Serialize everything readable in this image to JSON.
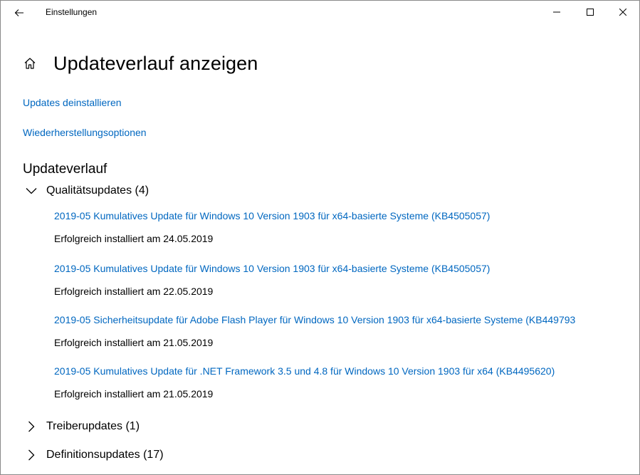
{
  "window": {
    "title": "Einstellungen",
    "controls": {
      "minimize": "—",
      "maximize": "☐",
      "close": "✕"
    },
    "back_icon": "arrow-left-icon"
  },
  "header": {
    "home_icon": "home-icon",
    "title": "Updateverlauf anzeigen"
  },
  "links": {
    "uninstall": "Updates deinstallieren",
    "recovery": "Wiederherstellungsoptionen"
  },
  "history": {
    "heading": "Updateverlauf",
    "groups": [
      {
        "label": "Qualitätsupdates (4)",
        "expanded": true,
        "items": [
          {
            "name": "2019-05 Kumulatives Update für Windows 10 Version 1903 für x64-basierte Systeme (KB4505057)",
            "status": "Erfolgreich installiert am 24.05.2019"
          },
          {
            "name": "2019-05 Kumulatives Update für Windows 10 Version 1903 für x64-basierte Systeme (KB4505057)",
            "status": "Erfolgreich installiert am 22.05.2019"
          },
          {
            "name": "2019-05 Sicherheitsupdate für Adobe Flash Player für Windows 10 Version 1903 für x64-basierte Systeme (KB449793",
            "status": "Erfolgreich installiert am 21.05.2019"
          },
          {
            "name": "2019-05 Kumulatives Update für .NET Framework 3.5 und 4.8 für Windows 10 Version 1903 für x64 (KB4495620)",
            "status": "Erfolgreich installiert am 21.05.2019"
          }
        ]
      },
      {
        "label": "Treiberupdates (1)",
        "expanded": false
      },
      {
        "label": "Definitionsupdates (17)",
        "expanded": false
      }
    ]
  },
  "colors": {
    "link": "#0067c0",
    "text": "#000000",
    "background": "#ffffff"
  }
}
